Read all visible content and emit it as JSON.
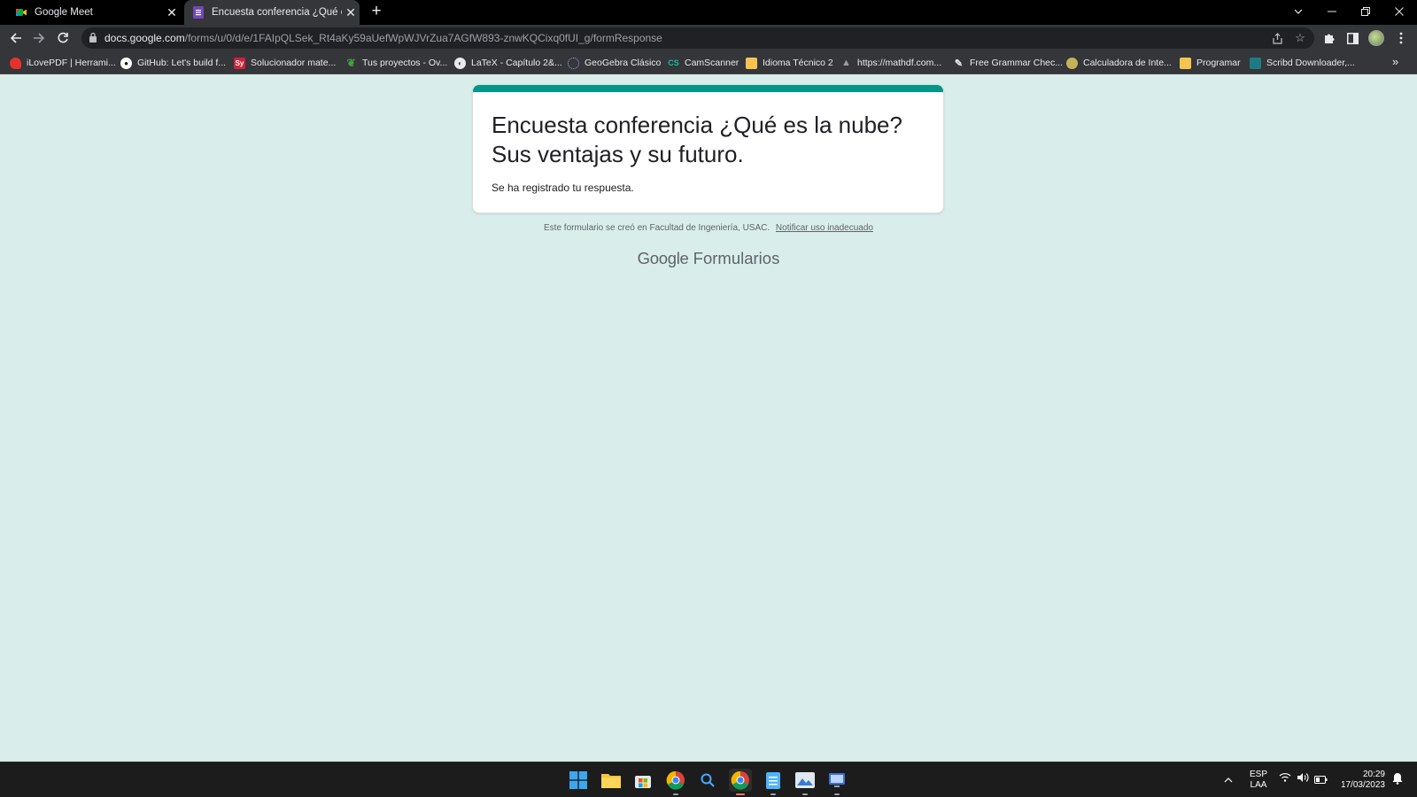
{
  "browser": {
    "tabs": [
      {
        "title": "Google Meet",
        "favicon": "google-meet-icon",
        "active": false
      },
      {
        "title": "Encuesta conferencia ¿Qué es la nube?",
        "favicon": "google-forms-icon",
        "active": true
      }
    ],
    "url_host": "docs.google.com",
    "url_path": "/forms/u/0/d/e/1FAIpQLSek_Rt4aKy59aUefWpWJVrZua7AGfW893-znwKQCixq0fUI_g/formResponse",
    "bookmarks": [
      {
        "label": "iLovePDF | Herrami...",
        "icon": "ilovepdf-icon",
        "color": "#e5322d"
      },
      {
        "label": "GitHub: Let's build f...",
        "icon": "github-icon",
        "color": "#ffffff"
      },
      {
        "label": "Solucionador mate...",
        "icon": "symbolab-icon",
        "color": "#d0213a"
      },
      {
        "label": "Tus proyectos - Ov...",
        "icon": "overleaf-icon",
        "color": "#47a141"
      },
      {
        "label": "LaTeX - Capítulo 2&...",
        "icon": "globe-icon",
        "color": "#e8eaed"
      },
      {
        "label": "GeoGebra Clásico",
        "icon": "geogebra-icon",
        "color": "#9fa8da"
      },
      {
        "label": "CamScanner",
        "icon": "camscanner-icon",
        "color": "#19bc9c"
      },
      {
        "label": "Idioma Técnico 2",
        "icon": "folder-icon",
        "color": "#f6c451"
      },
      {
        "label": "https://mathdf.com...",
        "icon": "mathdf-icon",
        "color": "#9aa0a6"
      },
      {
        "label": "Free Grammar Chec...",
        "icon": "grammar-icon",
        "color": "#e8eaed"
      },
      {
        "label": "Calculadora de Inte...",
        "icon": "calculator-icon",
        "color": "#c5b358"
      },
      {
        "label": "Programar",
        "icon": "folder-icon",
        "color": "#f6c451"
      },
      {
        "label": "Scribd Downloader,...",
        "icon": "scribd-icon",
        "color": "#1e7b85"
      }
    ]
  },
  "form": {
    "title": "Encuesta conferencia ¿Qué es la nube? Sus ventajas y su futuro.",
    "message": "Se ha registrado tu respuesta.",
    "footer_text": "Este formulario se creó en Facultad de Ingeniería, USAC.",
    "report_link": "Notificar uso inadecuado",
    "brand_google": "Google",
    "brand_product": "Formularios",
    "accent_color": "#009688",
    "background_color": "#d9eeeb"
  },
  "taskbar": {
    "language_top": "ESP",
    "language_bottom": "LAA",
    "time": "20:29",
    "date": "17/03/2023"
  }
}
